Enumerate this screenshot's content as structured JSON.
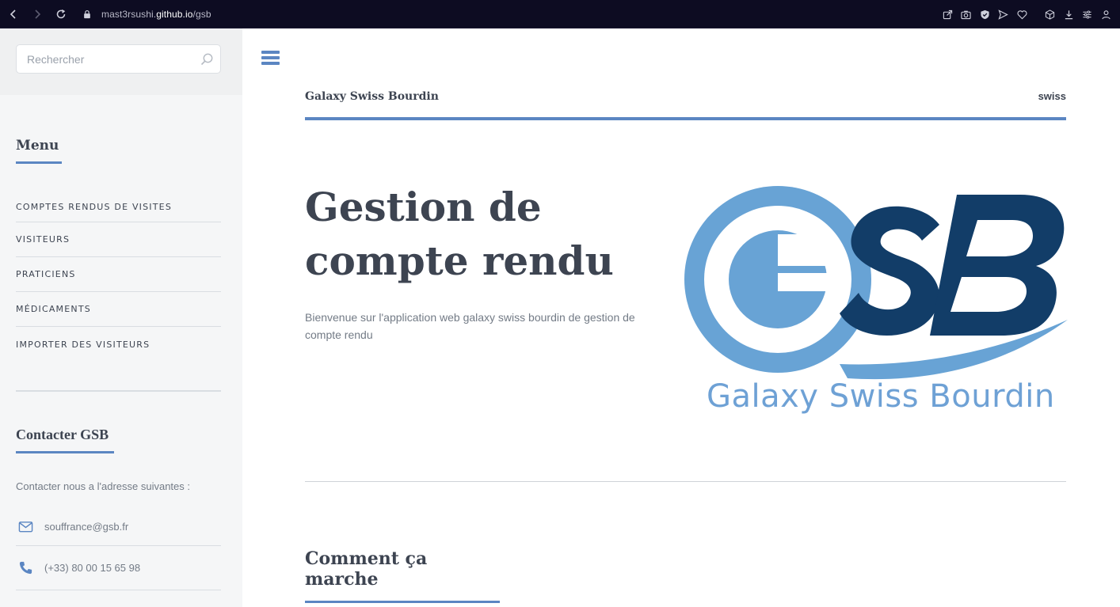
{
  "browser": {
    "url_prefix": "mast3rsushi.",
    "url_domain": "github.io",
    "url_path": "/gsb"
  },
  "sidebar": {
    "search": {
      "placeholder": "Rechercher"
    },
    "menu_title": "Menu",
    "menu_items": [
      {
        "label": "COMPTES RENDUS DE VISITES"
      },
      {
        "label": "VISITEURS"
      },
      {
        "label": "PRATICIENS"
      },
      {
        "label": "MÉDICAMENTS"
      },
      {
        "label": "IMPORTER DES VISITEURS"
      }
    ],
    "contact": {
      "title": "Contacter GSB",
      "intro": "Contacter nous a l'adresse suivantes :",
      "items": [
        {
          "icon": "envelope-icon",
          "text": "souffrance@gsb.fr"
        },
        {
          "icon": "phone-icon",
          "text": "(+33) 80 00 15 65 98"
        }
      ]
    }
  },
  "header": {
    "logo": "Galaxy Swiss Bourdin",
    "right_text": "swiss"
  },
  "banner": {
    "title": "Gestion de compte rendu",
    "description": "Bienvenue sur l'application web galaxy swiss bourdin de gestion de compte rendu",
    "image_caption": "Galaxy Swiss Bourdin"
  },
  "section": {
    "heading": "Comment ça marche"
  },
  "colors": {
    "accent": "#5b86c2",
    "logo_light_blue": "#68a3d5",
    "logo_dark_blue": "#123d68"
  }
}
